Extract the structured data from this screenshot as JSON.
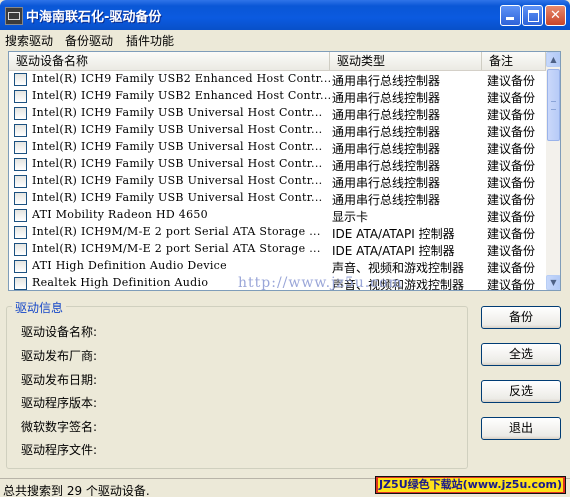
{
  "window": {
    "title": "中海南联石化-驱动备份"
  },
  "menu": [
    "搜索驱动",
    "备份驱动",
    "插件功能"
  ],
  "list": {
    "columns": [
      "驱动设备名称",
      "驱动类型",
      "备注"
    ],
    "rows": [
      {
        "name": "Intel(R) ICH9 Family USB2 Enhanced Host Contr...",
        "type": "通用串行总线控制器",
        "note": "建议备份"
      },
      {
        "name": "Intel(R) ICH9 Family USB2 Enhanced Host Contr...",
        "type": "通用串行总线控制器",
        "note": "建议备份"
      },
      {
        "name": "Intel(R) ICH9 Family USB Universal Host Contr...",
        "type": "通用串行总线控制器",
        "note": "建议备份"
      },
      {
        "name": "Intel(R) ICH9 Family USB Universal Host Contr...",
        "type": "通用串行总线控制器",
        "note": "建议备份"
      },
      {
        "name": "Intel(R) ICH9 Family USB Universal Host Contr...",
        "type": "通用串行总线控制器",
        "note": "建议备份"
      },
      {
        "name": "Intel(R) ICH9 Family USB Universal Host Contr...",
        "type": "通用串行总线控制器",
        "note": "建议备份"
      },
      {
        "name": "Intel(R) ICH9 Family USB Universal Host Contr...",
        "type": "通用串行总线控制器",
        "note": "建议备份"
      },
      {
        "name": "Intel(R) ICH9 Family USB Universal Host Contr...",
        "type": "通用串行总线控制器",
        "note": "建议备份"
      },
      {
        "name": "ATI Mobility Radeon HD 4650",
        "type": "显示卡",
        "note": "建议备份"
      },
      {
        "name": "Intel(R) ICH9M/M-E 2 port Serial ATA Storage ...",
        "type": "IDE ATA/ATAPI 控制器",
        "note": "建议备份"
      },
      {
        "name": "Intel(R) ICH9M/M-E 2 port Serial ATA Storage ...",
        "type": "IDE ATA/ATAPI 控制器",
        "note": "建议备份"
      },
      {
        "name": "ATI High Definition Audio Device",
        "type": "声音、视频和游戏控制器",
        "note": "建议备份"
      },
      {
        "name": "Realtek High Definition Audio",
        "type": "声音、视频和游戏控制器",
        "note": "建议备份"
      }
    ]
  },
  "info": {
    "title": "驱动信息",
    "labels": [
      "驱动设备名称:",
      "驱动发布厂商:",
      "驱动发布日期:",
      "驱动程序版本:",
      "微软数字签名:",
      "驱动程序文件:"
    ]
  },
  "buttons": {
    "backup": "备份",
    "select_all": "全选",
    "invert": "反选",
    "exit": "退出"
  },
  "status": "总共搜索到 29 个驱动设备.",
  "watermark": "http://www.jz5u.com",
  "badge": "JZ5U绿色下载站(www.jz5u.com)",
  "colors": {
    "titlebar": "#0b5ae0",
    "group_title": "#1547c8",
    "badge_bg": "#ffe21a"
  }
}
